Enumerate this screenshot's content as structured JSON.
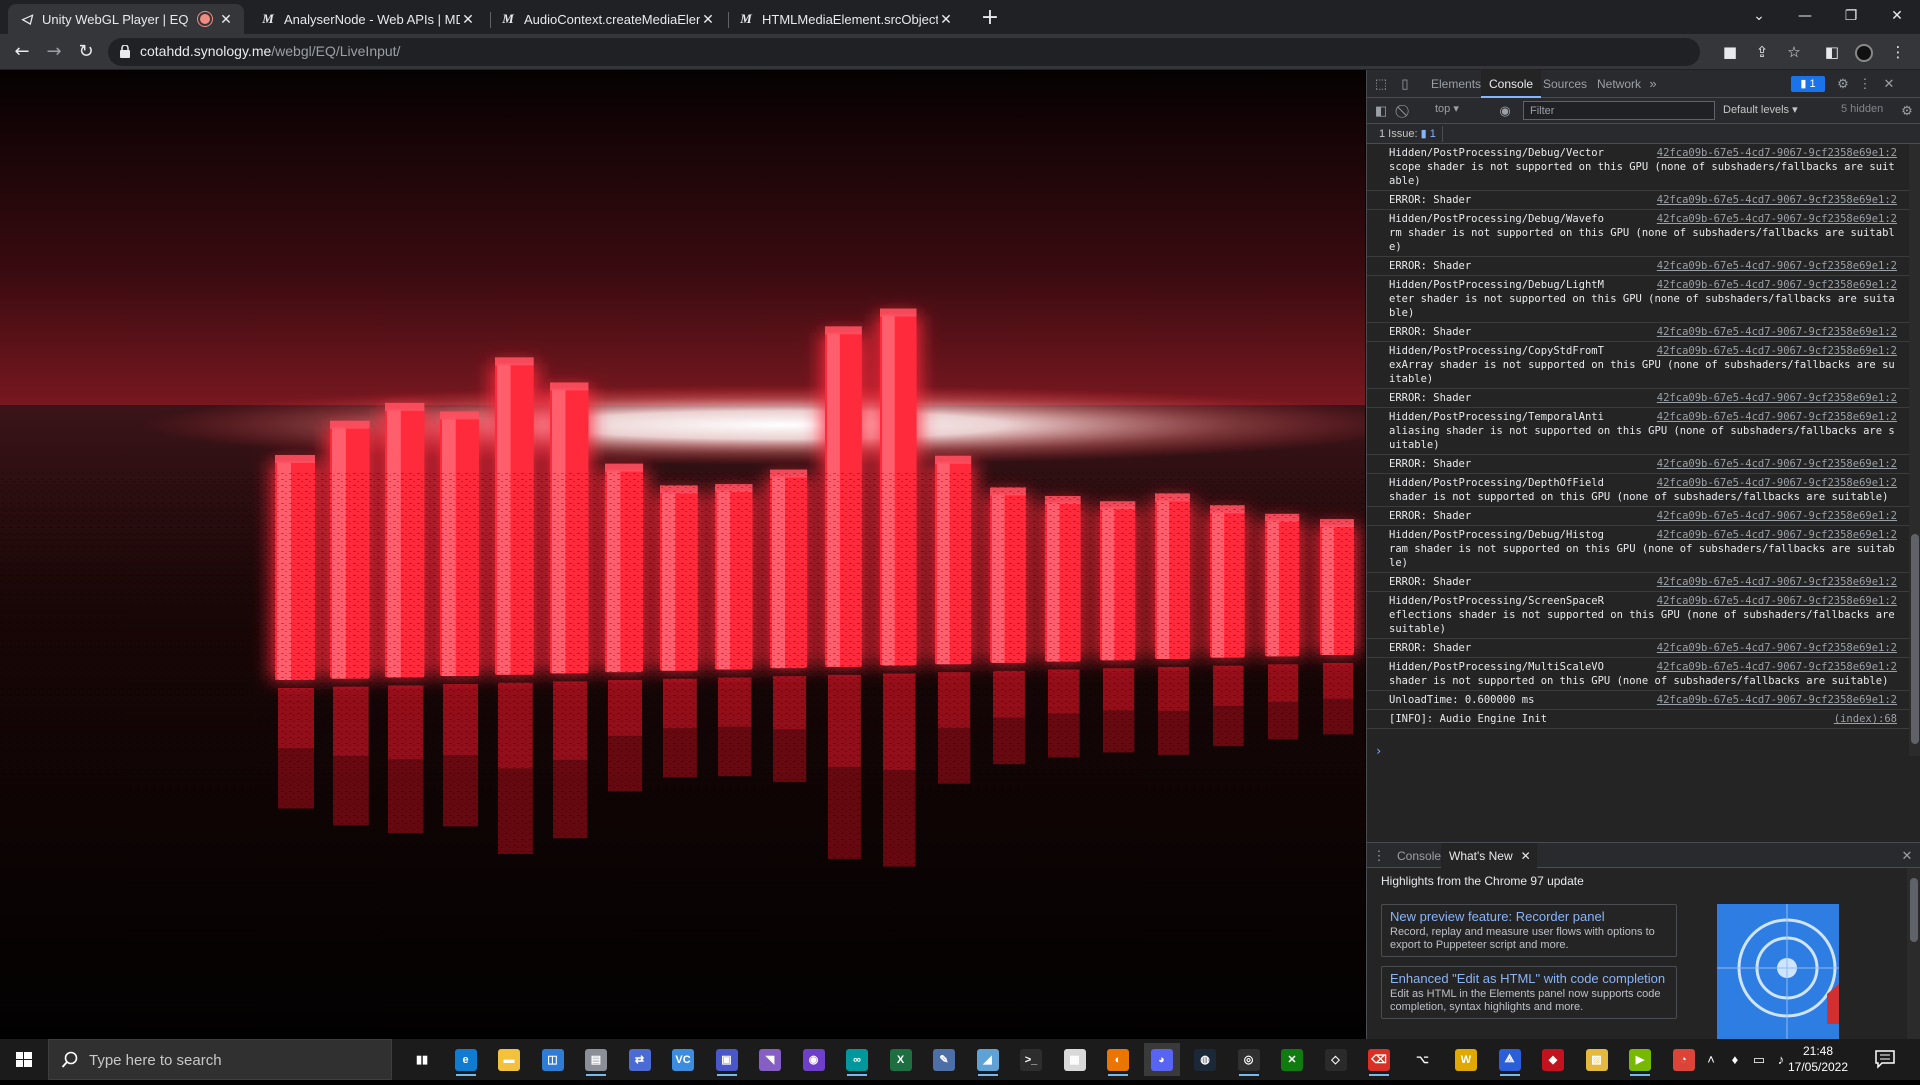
{
  "browser": {
    "tabs": [
      {
        "title": "Unity WebGL Player | EQ Live",
        "favicon": "unity-icon",
        "recording": true,
        "active": true
      },
      {
        "title": "AnalyserNode - Web APIs | MDN",
        "favicon": "mdn-icon",
        "active": false
      },
      {
        "title": "AudioContext.createMediaEleme",
        "favicon": "mdn-icon",
        "active": false
      },
      {
        "title": "HTMLMediaElement.srcObject - W",
        "favicon": "mdn-icon",
        "active": false
      }
    ],
    "url_host": "cotahdd.synology.me",
    "url_path": "/webgl/EQ/LiveInput/"
  },
  "devtools": {
    "tabs": [
      "Elements",
      "Console",
      "Sources",
      "Network"
    ],
    "active_tab": "Console",
    "issues_badge": "1",
    "context": "top",
    "filter_placeholder": "Filter",
    "levels": "Default levels",
    "hidden": "5 hidden",
    "issues_label": "1 Issue:",
    "issues_count": "1",
    "console_messages": [
      {
        "text": "Hidden/PostProcessing/Debug/Vector\nscope shader is not supported on this GPU (none of subshaders/fallbacks are suitable)",
        "source": "42fca09b-67e5-4cd7-9067-9cf2358e69e1:2"
      },
      {
        "text": "ERROR: Shader",
        "source": "42fca09b-67e5-4cd7-9067-9cf2358e69e1:2"
      },
      {
        "text": "Hidden/PostProcessing/Debug/Wavefo\nrm shader is not supported on this GPU (none of subshaders/fallbacks are suitable)",
        "source": "42fca09b-67e5-4cd7-9067-9cf2358e69e1:2"
      },
      {
        "text": "ERROR: Shader",
        "source": "42fca09b-67e5-4cd7-9067-9cf2358e69e1:2"
      },
      {
        "text": "Hidden/PostProcessing/Debug/LightM\neter shader is not supported on this GPU (none of subshaders/fallbacks are suitable)",
        "source": "42fca09b-67e5-4cd7-9067-9cf2358e69e1:2"
      },
      {
        "text": "ERROR: Shader",
        "source": "42fca09b-67e5-4cd7-9067-9cf2358e69e1:2"
      },
      {
        "text": "Hidden/PostProcessing/CopyStdFromT\nexArray shader is not supported on this GPU (none of subshaders/fallbacks are suitable)",
        "source": "42fca09b-67e5-4cd7-9067-9cf2358e69e1:2"
      },
      {
        "text": "ERROR: Shader",
        "source": "42fca09b-67e5-4cd7-9067-9cf2358e69e1:2"
      },
      {
        "text": "Hidden/PostProcessing/TemporalAnti\naliasing shader is not supported on this GPU (none of subshaders/fallbacks are suitable)",
        "source": "42fca09b-67e5-4cd7-9067-9cf2358e69e1:2"
      },
      {
        "text": "ERROR: Shader",
        "source": "42fca09b-67e5-4cd7-9067-9cf2358e69e1:2"
      },
      {
        "text": "Hidden/PostProcessing/DepthOfField\nshader is not supported on this GPU (none of subshaders/fallbacks are suitable)",
        "source": "42fca09b-67e5-4cd7-9067-9cf2358e69e1:2"
      },
      {
        "text": "ERROR: Shader",
        "source": "42fca09b-67e5-4cd7-9067-9cf2358e69e1:2"
      },
      {
        "text": "Hidden/PostProcessing/Debug/Histog\nram shader is not supported on this GPU (none of subshaders/fallbacks are suitable)",
        "source": "42fca09b-67e5-4cd7-9067-9cf2358e69e1:2"
      },
      {
        "text": "ERROR: Shader",
        "source": "42fca09b-67e5-4cd7-9067-9cf2358e69e1:2"
      },
      {
        "text": "Hidden/PostProcessing/ScreenSpaceR\neflections shader is not supported on this GPU (none of subshaders/fallbacks are suitable)",
        "source": "42fca09b-67e5-4cd7-9067-9cf2358e69e1:2"
      },
      {
        "text": "ERROR: Shader",
        "source": "42fca09b-67e5-4cd7-9067-9cf2358e69e1:2"
      },
      {
        "text": "Hidden/PostProcessing/MultiScaleVO\nshader is not supported on this GPU (none of subshaders/fallbacks are suitable)",
        "source": "42fca09b-67e5-4cd7-9067-9cf2358e69e1:2"
      },
      {
        "text": "UnloadTime: 0.600000 ms",
        "source": "42fca09b-67e5-4cd7-9067-9cf2358e69e1:2"
      },
      {
        "text": "[INFO]: Audio Engine Init",
        "source": "(index):68"
      }
    ],
    "drawer": {
      "tabs": [
        "Console",
        "What's New"
      ],
      "active_tab": "What's New",
      "highlights_title": "Highlights from the Chrome 97 update",
      "cards": [
        {
          "title": "New preview feature: Recorder panel",
          "body": "Record, replay and measure user flows with options to export to Puppeteer script and more."
        },
        {
          "title": "Enhanced \"Edit as HTML\" with code completion",
          "body": "Edit as HTML in the Elements panel now supports code completion, syntax highlights and more."
        }
      ]
    }
  },
  "webgl": {
    "bar_color": "#ff2a3c",
    "bars": [
      {
        "level": 0.3
      },
      {
        "level": 0.4
      },
      {
        "level": 0.45
      },
      {
        "level": 0.42
      },
      {
        "level": 0.58
      },
      {
        "level": 0.5
      },
      {
        "level": 0.25
      },
      {
        "level": 0.18
      },
      {
        "level": 0.18
      },
      {
        "level": 0.22
      },
      {
        "level": 0.65
      },
      {
        "level": 0.7
      },
      {
        "level": 0.25
      },
      {
        "level": 0.15
      },
      {
        "level": 0.12
      },
      {
        "level": 0.1
      },
      {
        "level": 0.12
      },
      {
        "level": 0.08
      },
      {
        "level": 0.05
      },
      {
        "level": 0.03
      }
    ]
  },
  "taskbar": {
    "search_placeholder": "Type here to search",
    "time": "21:48",
    "date": "17/05/2022",
    "apps": [
      {
        "name": "task-view-icon",
        "glyph": "▮▮",
        "color": "#1b1b1b"
      },
      {
        "name": "edge-icon",
        "glyph": "e",
        "color": "#0f7bd1"
      },
      {
        "name": "file-explorer-icon",
        "glyph": "▬",
        "color": "#f3c13a"
      },
      {
        "name": "store-icon",
        "glyph": "◫",
        "color": "#2e7cd6"
      },
      {
        "name": "printer-app-icon",
        "glyph": "▤",
        "color": "#8a8f98"
      },
      {
        "name": "network-app-icon",
        "glyph": "⇄",
        "color": "#4a6cd4"
      },
      {
        "name": "vscode-icon",
        "glyph": "VC",
        "color": "#3c8de0"
      },
      {
        "name": "teams-like-icon",
        "glyph": "▣",
        "color": "#4957c9"
      },
      {
        "name": "visual-studio-icon",
        "glyph": "◥",
        "color": "#865fc5"
      },
      {
        "name": "github-icon",
        "glyph": "◉",
        "color": "#6e40c9"
      },
      {
        "name": "arduino-icon",
        "glyph": "∞",
        "color": "#00979d"
      },
      {
        "name": "excel-icon",
        "glyph": "X",
        "color": "#1d6f42"
      },
      {
        "name": "krita-icon",
        "glyph": "✎",
        "color": "#4c6fa8"
      },
      {
        "name": "notes-icon",
        "glyph": "◢",
        "color": "#5fa3d6"
      },
      {
        "name": "terminal-icon",
        "glyph": ">_",
        "color": "#2d2d2d"
      },
      {
        "name": "file-icon",
        "glyph": "▦",
        "color": "#d9d9d9"
      },
      {
        "name": "blender-icon",
        "glyph": "◐",
        "color": "#ea7600"
      },
      {
        "name": "discord-icon",
        "glyph": "◕",
        "color": "#5865f2"
      },
      {
        "name": "steam-icon",
        "glyph": "◍",
        "color": "#1b2838"
      },
      {
        "name": "obs-icon",
        "glyph": "◎",
        "color": "#303030"
      },
      {
        "name": "xbox-icon",
        "glyph": "✕",
        "color": "#107c10"
      },
      {
        "name": "unity-icon",
        "glyph": "◇",
        "color": "#2a2a2a"
      },
      {
        "name": "trash-app-icon",
        "glyph": "⌫",
        "color": "#d93025"
      },
      {
        "name": "unity-hub-icon",
        "glyph": "⌥",
        "color": "#1b1b1b"
      },
      {
        "name": "word-icon",
        "glyph": "W",
        "color": "#e0a800"
      },
      {
        "name": "azure-icon",
        "glyph": "⟁",
        "color": "#2b5fd9"
      },
      {
        "name": "red-app-icon",
        "glyph": "◆",
        "color": "#c2121e"
      },
      {
        "name": "photos-icon",
        "glyph": "▨",
        "color": "#e5b93b"
      },
      {
        "name": "nvidia-icon",
        "glyph": "▶",
        "color": "#76b900"
      },
      {
        "name": "chrome-icon",
        "glyph": "◔",
        "color": "#db4437"
      }
    ]
  }
}
